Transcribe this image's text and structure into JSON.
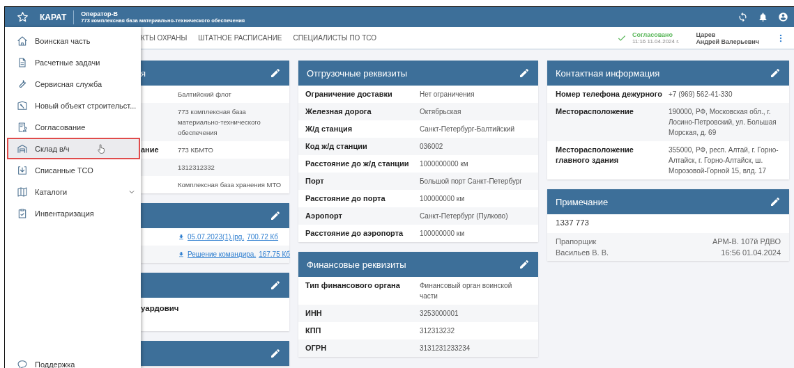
{
  "header": {
    "app_name": "КАРАТ",
    "operator": "Оператор-В",
    "organization": "773 комплексная база материально-технического обеспечения"
  },
  "drawer": {
    "items": [
      {
        "label": "Воинская часть",
        "selected": false,
        "has_submenu": false
      },
      {
        "label": "Расчетные задачи",
        "selected": false,
        "has_submenu": false
      },
      {
        "label": "Сервисная служба",
        "selected": false,
        "has_submenu": false
      },
      {
        "label": "Новый объект строительст...",
        "selected": false,
        "has_submenu": false
      },
      {
        "label": "Согласование",
        "selected": false,
        "has_submenu": false
      },
      {
        "label": "Склад в/ч",
        "selected": true,
        "has_submenu": false
      },
      {
        "label": "Списанные ТСО",
        "selected": false,
        "has_submenu": false
      },
      {
        "label": "Каталоги",
        "selected": false,
        "has_submenu": true
      },
      {
        "label": "Инвентаризация",
        "selected": false,
        "has_submenu": false
      }
    ],
    "footer_item": {
      "label": "Поддержка"
    }
  },
  "tabs": [
    {
      "label": "КТЫ ОХРАНЫ",
      "selected": false
    },
    {
      "label": "ШТАТНОЕ РАСПИСАНИЕ",
      "selected": false
    },
    {
      "label": "СПЕЦИАЛИСТЫ ПО ТСО",
      "selected": false
    }
  ],
  "approval": {
    "status": "Согласовано",
    "time": "11:16 11.04.2024 г.",
    "approver_surname": "Царев",
    "approver_name": "Андрей Валерьевич"
  },
  "columns": [
    {
      "cards": [
        {
          "kind": "fields",
          "title": "я",
          "rows": [
            {
              "value": "Балтийский флот"
            },
            {
              "value": "773 комплексная база материально-технического обеспечения"
            },
            {
              "label": "ание",
              "value": "773 КБМТО"
            },
            {
              "value": "1312312332"
            },
            {
              "value": "Комплексная база хранения МТО"
            }
          ]
        },
        {
          "kind": "files",
          "files": [
            {
              "name": "05.07.2023(1).jpg,",
              "size": "700.72 Кб"
            },
            {
              "name": "Решение командира.",
              "size": "167.75 Кб"
            }
          ]
        },
        {
          "kind": "text",
          "text": "уардович"
        },
        {
          "kind": "empty"
        }
      ]
    },
    {
      "cards": [
        {
          "kind": "fields",
          "title": "Отгрузочные реквизиты",
          "rows": [
            {
              "label": "Ограничение доставки",
              "value": "Нет ограничения"
            },
            {
              "label": "Железная дорога",
              "value": "Октябрьская"
            },
            {
              "label": "Ж/д станция",
              "value": "Санкт-Петербург-Балтийский"
            },
            {
              "label": "Код ж/д станции",
              "value": "036002"
            },
            {
              "label": "Расстояние до ж/д станции",
              "value": "1000000000 км"
            },
            {
              "label": "Порт",
              "value": "Большой порт Санкт-Петербург"
            },
            {
              "label": "Расстояние до порта",
              "value": "100000000 км"
            },
            {
              "label": "Аэропорт",
              "value": "Санкт-Петербург (Пулково)"
            },
            {
              "label": "Расстояние до аэропорта",
              "value": "100000000 км"
            }
          ]
        },
        {
          "kind": "fields",
          "title": "Финансовые реквизиты",
          "rows": [
            {
              "label": "Тип финансового органа",
              "value": "Финансовый орган воинской части"
            },
            {
              "label": "ИНН",
              "value": "3253000001"
            },
            {
              "label": "КПП",
              "value": "312313232"
            },
            {
              "label": "ОГРН",
              "value": "3131231233234"
            }
          ]
        }
      ]
    },
    {
      "cards": [
        {
          "kind": "fields",
          "title": "Контактная информация",
          "rows": [
            {
              "label": "Номер телефона дежурного",
              "value": "+7 (969) 562-41-330"
            },
            {
              "label": "Месторасположение",
              "value": "190000, РФ, Московская обл., г. Лосино-Петровский, ул. Большая Морская, д. 69"
            },
            {
              "label": "Месторасположение главного здания",
              "value": "355000, РФ, респ. Алтай, г. Горно-Алтайск, г. Горно-Алтайск, ш. Морозовой-Горной 15, влд. 17"
            }
          ]
        },
        {
          "kind": "note",
          "title": "Примечание",
          "text": "1337 773",
          "author_rank": "Прапорщик",
          "author_name": "Васильев В. В.",
          "source": "АРМ-В. 107й РДВО",
          "datetime": "16:56  01.04.2024"
        }
      ]
    }
  ]
}
